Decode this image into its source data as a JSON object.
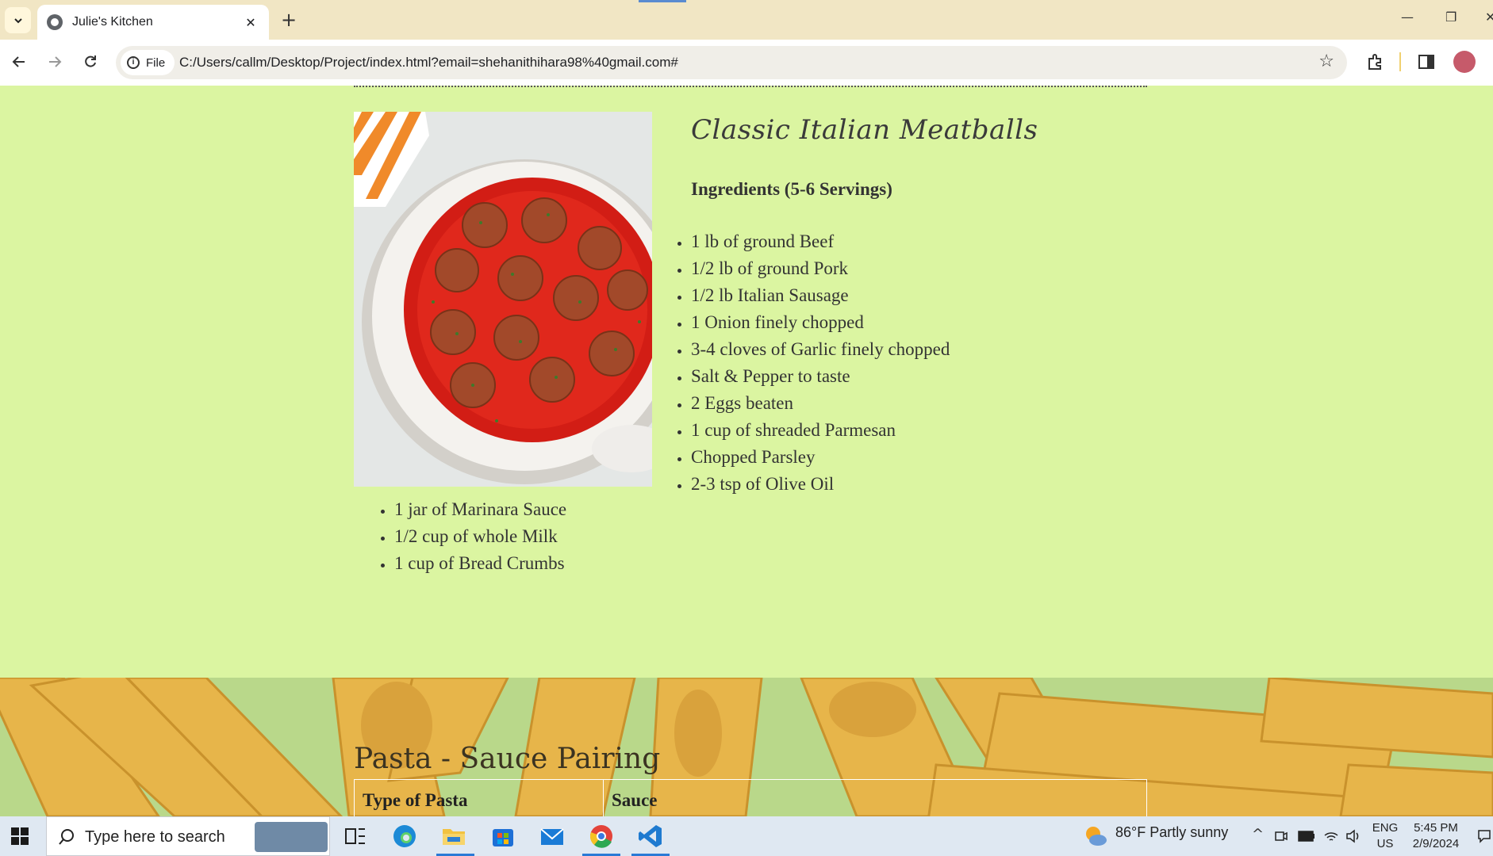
{
  "browser": {
    "tab_title": "Julie's Kitchen",
    "url_chip": "File",
    "url": "C:/Users/callm/Desktop/Project/index.html?email=shehanithihara98%40gmail.com#"
  },
  "recipe": {
    "title": "Classic Italian Meatballs",
    "ingredients_heading": "Ingredients (5-6 Servings)",
    "ingredients_right": [
      "1 lb of ground Beef",
      "1/2 lb of ground Pork",
      "1/2 lb Italian Sausage",
      "1 Onion finely chopped",
      "3-4 cloves of Garlic finely chopped",
      "Salt & Pepper to taste",
      "2 Eggs beaten",
      "1 cup of shreaded Parmesan",
      "Chopped Parsley",
      "2-3 tsp of Olive Oil"
    ],
    "ingredients_left": [
      "1 jar of Marinara Sauce",
      "1/2 cup of whole Milk",
      "1 cup of Bread Crumbs"
    ]
  },
  "pairing": {
    "title": "Pasta - Sauce Pairing",
    "columns": [
      "Type of Pasta",
      "Sauce"
    ]
  },
  "taskbar": {
    "search_placeholder": "Type here to search",
    "weather": "86°F  Partly sunny",
    "lang_top": "ENG",
    "lang_bottom": "US",
    "time": "5:45 PM",
    "date": "2/9/2024"
  },
  "colors": {
    "page_bg": "#dbf5a1",
    "tabstrip_bg": "#f1e6c4",
    "taskbar_bg": "#dfe8f2"
  }
}
